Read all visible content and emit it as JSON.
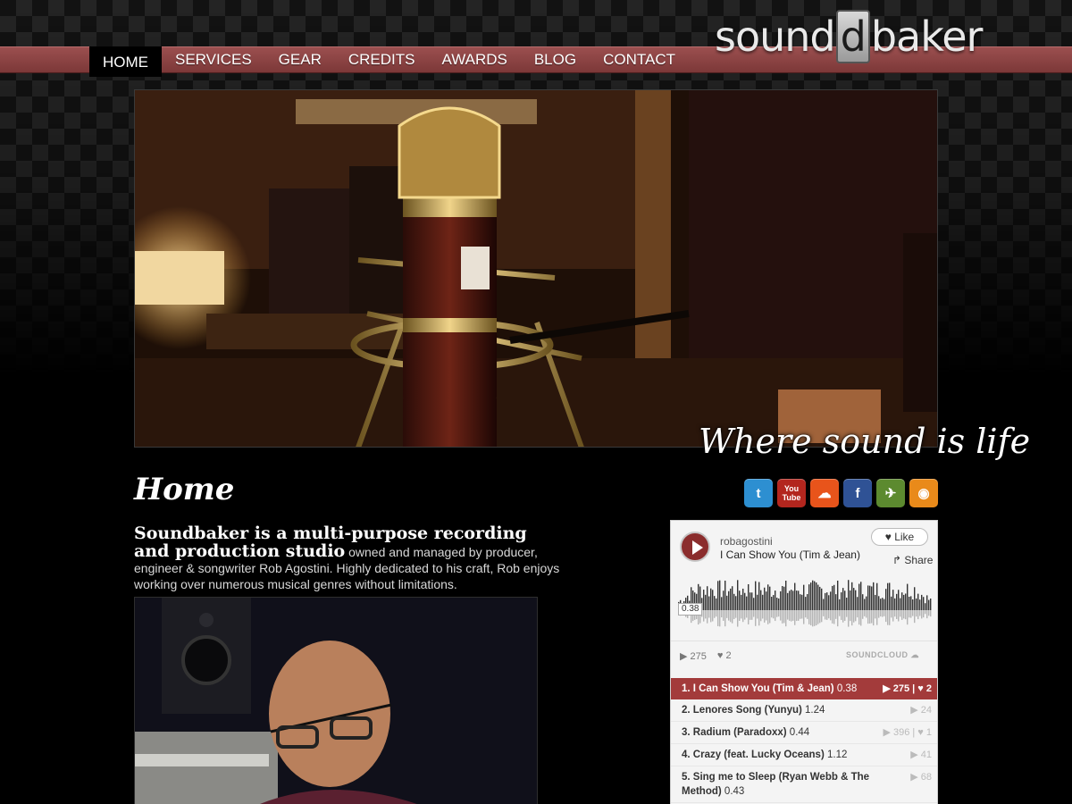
{
  "nav": {
    "items": [
      {
        "label": "HOME",
        "active": true
      },
      {
        "label": "SERVICES",
        "active": false
      },
      {
        "label": "GEAR",
        "active": false
      },
      {
        "label": "CREDITS",
        "active": false
      },
      {
        "label": "AWARDS",
        "active": false
      },
      {
        "label": "BLOG",
        "active": false
      },
      {
        "label": "CONTACT",
        "active": false
      }
    ]
  },
  "logo": {
    "pre": "sound",
    "box": "d",
    "post": "baker"
  },
  "hero": {
    "tagline": "Where sound is life"
  },
  "page": {
    "title": "Home"
  },
  "social": [
    {
      "name": "twitter-icon",
      "glyph": "t",
      "color": "#2d8fd1"
    },
    {
      "name": "youtube-icon",
      "glyph": "You Tube",
      "color": "#b3261e"
    },
    {
      "name": "soundcloud-icon",
      "glyph": "☁",
      "color": "#e8541b"
    },
    {
      "name": "facebook-icon",
      "glyph": "f",
      "color": "#2f5295"
    },
    {
      "name": "yousendit-icon",
      "glyph": "✈",
      "color": "#5c8a2f"
    },
    {
      "name": "rss-icon",
      "glyph": "◉",
      "color": "#e98a1a"
    }
  ],
  "intro": {
    "lead": "Soundbaker is a multi-purpose recording and production studio",
    "body": " owned and managed by producer, engineer & songwriter Rob Agostini. Highly dedicated to his craft, Rob enjoys working over numerous musical genres without limitations."
  },
  "player": {
    "artist": "robagostini",
    "track": "I Can Show You (Tim & Jean)",
    "like_label": "♥ Like",
    "share_label": "Share",
    "time": "0.38",
    "progress": 0.0,
    "plays": "275",
    "likes": "2",
    "brand": "SOUNDCLOUD",
    "playlist": [
      {
        "title": "1. I Can Show You (Tim & Jean)",
        "duration": "0.38",
        "plays": "275",
        "likes": "2",
        "active": true
      },
      {
        "title": "2. Lenores Song (Yunyu)",
        "duration": "1.24",
        "plays": "24",
        "likes": "",
        "active": false
      },
      {
        "title": "3. Radium (Paradoxx)",
        "duration": "0.44",
        "plays": "396",
        "likes": "1",
        "active": false
      },
      {
        "title": "4. Crazy (feat. Lucky Oceans)",
        "duration": "1.12",
        "plays": "41",
        "likes": "",
        "active": false
      },
      {
        "title": "5. Sing me to Sleep (Ryan Webb & The Method)",
        "duration": "0.43",
        "plays": "68",
        "likes": "",
        "active": false
      }
    ]
  }
}
